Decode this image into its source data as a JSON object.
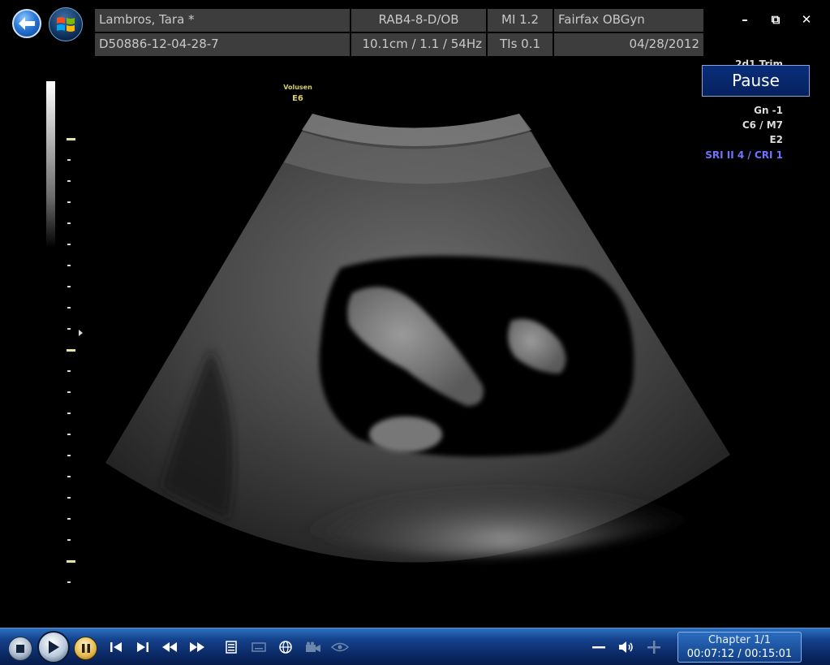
{
  "header": {
    "patient_name": "Lambros, Tara *",
    "probe": "RAB4-8-D/OB",
    "mi": "MI 1.2",
    "clinic": "Fairfax OBGyn",
    "patient_id": "D50886-12-04-28-7",
    "depth_freq": "10.1cm / 1.1 / 54Hz",
    "tis": "TIs 0.1",
    "date": "04/28/2012"
  },
  "window_controls": {
    "minimize": "–",
    "restore": "⧉",
    "close": "✕"
  },
  "pause_button": "Pause",
  "params": {
    "partial_1": "2d1 Trim",
    "gn": "Gn  -1",
    "c_m": "C6 / M7",
    "e": "E2",
    "sri": "SRI II 4 / CRI 1"
  },
  "volume_label": {
    "line1": "Volusen",
    "line2": "E6"
  },
  "player": {
    "chapter": "Chapter 1/1",
    "time": "00:07:12 / 00:15:01"
  },
  "colors": {
    "control_bar": "#0b2a66",
    "pause_button": "#0a2e7c",
    "sri_text": "#6f74ff"
  }
}
